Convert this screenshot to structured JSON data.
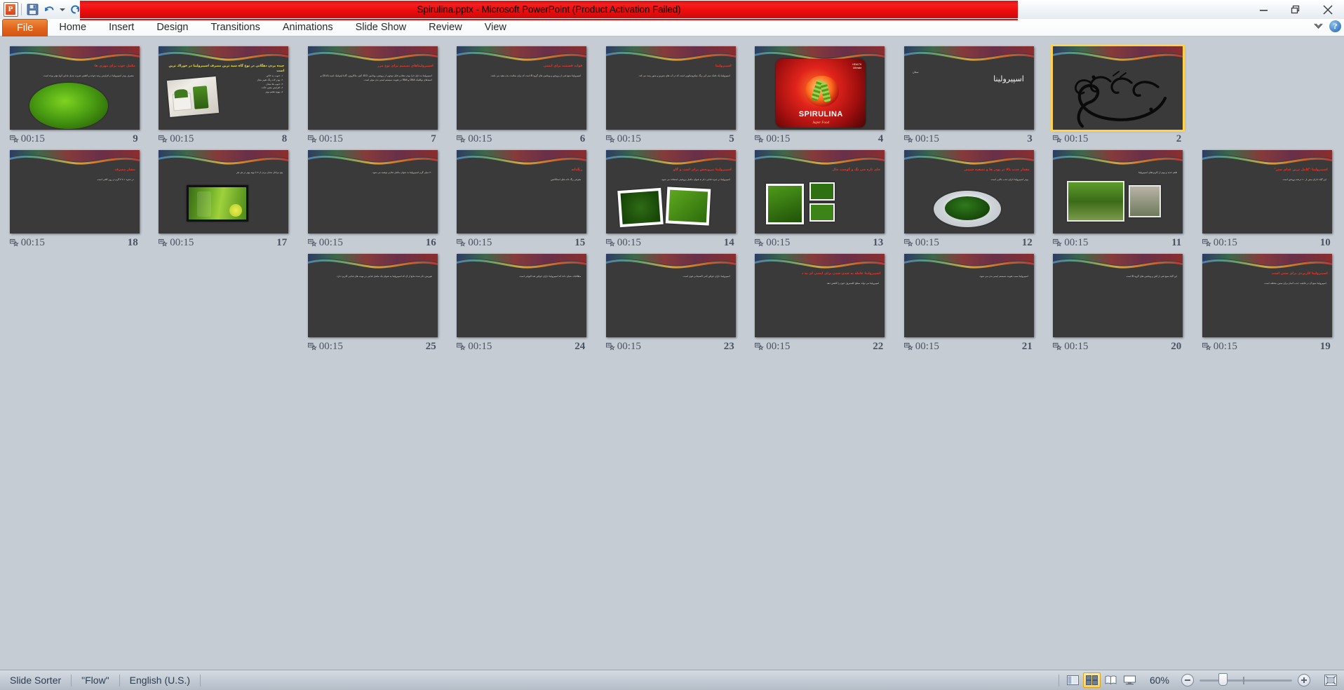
{
  "window": {
    "title": "Spirulina.pptx  -  Microsoft PowerPoint (Product Activation Failed)",
    "minimize_label": "—",
    "restore_label": "restore",
    "close_label": "✕"
  },
  "quick_access": {
    "app_logo": "P",
    "items": [
      {
        "name": "save-icon",
        "label": "Save"
      },
      {
        "name": "undo-icon",
        "label": "Undo"
      },
      {
        "name": "undo-dropdown-icon",
        "label": "Undo history"
      },
      {
        "name": "redo-icon",
        "label": "Repeat"
      },
      {
        "name": "customize-qat-icon",
        "label": "Customize Quick Access Toolbar"
      }
    ]
  },
  "ribbon": {
    "tabs": [
      {
        "label": "File",
        "active": true
      },
      {
        "label": "Home",
        "active": false
      },
      {
        "label": "Insert",
        "active": false
      },
      {
        "label": "Design",
        "active": false
      },
      {
        "label": "Transitions",
        "active": false
      },
      {
        "label": "Animations",
        "active": false
      },
      {
        "label": "Slide Show",
        "active": false
      },
      {
        "label": "Review",
        "active": false
      },
      {
        "label": "View",
        "active": false
      }
    ],
    "minimize_ribbon_label": "Minimize the Ribbon",
    "help_label": "?"
  },
  "status_bar": {
    "view_name": "Slide Sorter",
    "theme_name": "\"Flow\"",
    "language": "English (U.S.)",
    "zoom_percent": "60%",
    "view_buttons": [
      {
        "name": "view-normal",
        "label": "Normal",
        "active": false
      },
      {
        "name": "view-slide-sorter",
        "label": "Slide Sorter",
        "active": true
      },
      {
        "name": "view-reading",
        "label": "Reading View",
        "active": false
      },
      {
        "name": "view-slideshow",
        "label": "Slide Show",
        "active": false
      }
    ],
    "zoom_out_label": "Zoom Out",
    "zoom_in_label": "Zoom In",
    "fit_label": "Fit slide to current window"
  },
  "slides_common": {
    "timing": "00:15",
    "transition_icon": "transition-star-icon"
  },
  "slides": [
    {
      "number": "9",
      "row": 0,
      "col": 0,
      "selected": false,
      "kind": "title-image",
      "title": "مكمل خوب برای مهری ها",
      "body": "مصرف پودر اسپیرولینا در افزایش رشد جوجه و كاهش ضریب تبدیل غذایی آنها مؤثر بوده است.",
      "image": "green-algae-oval"
    },
    {
      "number": "8",
      "row": 0,
      "col": 1,
      "selected": false,
      "kind": "title-list-image",
      "title": "چیده بردن دهگانی در نوع گاه سیه ترین مصرف اسپیرولینا در خوراك ترین است",
      "body": "١- حبوب به خاص\n٢- پودر لانه رنگ تغییر مجاز\n٣- حبوب ها نشان\n٤- افزایش معین حالت\n٥- بهبود هضم بهتر",
      "image": "green-powder-cups"
    },
    {
      "number": "7",
      "row": 0,
      "col": 2,
      "selected": false,
      "kind": "title-text",
      "title": "اسپیرولیناهای تصمیم برای نوع مزر",
      "body": "اسپیرولینا به دلیل دارا بودن مقادیر قابل توجهی از پروتئین، ویتامین B12، آهن، بتاکاروتن، گاما لینولنیک اسید (GLA) و اسیدهای نوکلئیک DNA و RNA در تقویت سیستم ایمنی بدن مؤثر است.",
      "image": ""
    },
    {
      "number": "6",
      "row": 0,
      "col": 3,
      "selected": false,
      "kind": "title-text",
      "title": "فواید قسمت برای ایمنی",
      "body": "اسپیرولینا منبع غنی از پروتئین و ویتامین های گروه B است که برای سلامت بدن مفید می باشد.",
      "image": ""
    },
    {
      "number": "5",
      "row": 0,
      "col": 4,
      "selected": false,
      "kind": "title-text",
      "title": "اسپیرولینا",
      "body": "اسپیرولینا یک جلبک سبز آبی رنگ میکروسکوپی است که در آب های شیرین و شور رشد می کند.",
      "image": ""
    },
    {
      "number": "4",
      "row": 0,
      "col": 5,
      "selected": false,
      "kind": "product",
      "title": "SPIRULINA",
      "body": "Super Food",
      "image": "spirulina-red-box"
    },
    {
      "number": "3",
      "row": 0,
      "col": 6,
      "selected": false,
      "kind": "big-title",
      "title": "اسپیرولینا",
      "body": "",
      "image": ""
    },
    {
      "number": "2",
      "row": 0,
      "col": 7,
      "selected": true,
      "kind": "bismillah",
      "title": "بسم الله الرحمن الرحیم",
      "body": "",
      "image": "bismillah-calligraphy"
    },
    {
      "number": "18",
      "row": 1,
      "col": 0,
      "selected": false,
      "kind": "title-text",
      "title": "مشار مصرف",
      "body": "در حدود ۱ تا ۳ گرم در روز کافی است.",
      "image": ""
    },
    {
      "number": "17",
      "row": 1,
      "col": 1,
      "selected": false,
      "kind": "title-image",
      "title": "",
      "body": "پنج مراحل نشان بردن از ۳ تا تهیه بهتر در هر نفر",
      "image": "green-juice-glass"
    },
    {
      "number": "16",
      "row": 1,
      "col": 2,
      "selected": false,
      "kind": "title-text",
      "title": "",
      "body": "۳۰ میلی گرم اسپیرولینا به عنوان مکمل غذایی توصیه می شود.",
      "image": ""
    },
    {
      "number": "15",
      "row": 1,
      "col": 3,
      "selected": false,
      "kind": "title-text",
      "title": "رنگدانه",
      "body": "معرفی رنگ دانه های استاکانتین",
      "image": ""
    },
    {
      "number": "14",
      "row": 1,
      "col": 4,
      "selected": false,
      "kind": "title-image2",
      "title": "اسپیرولینا نیروبخش برای اسب و گاو",
      "body": "اسپیرولینا در جیره غذایی دام به عنوان مکمل پروتئینی استفاده می شود.",
      "image": "algae-two-photos"
    },
    {
      "number": "13",
      "row": 1,
      "col": 5,
      "selected": false,
      "kind": "title-image2",
      "title": "جای تازه جی نگ و گوست چال",
      "body": "",
      "image": "algae-grid-photos"
    },
    {
      "number": "12",
      "row": 1,
      "col": 6,
      "selected": false,
      "kind": "title-image",
      "title": "مقدار جذب بالا تر پودر ها و تصفیه شیمی",
      "body": "پودر اسپیرولینا دارای جذب بالایی است.",
      "image": "spirulina-powder-plate"
    },
    {
      "number": "11",
      "row": 1,
      "col": 7,
      "selected": false,
      "kind": "title-image",
      "title": "",
      "body": "طعم جدید و بهتر از کاربردهای اسپیرولینا",
      "image": "algae-farm-tanks"
    },
    {
      "number": "10",
      "row": 1,
      "col": 8,
      "selected": false,
      "kind": "title-text",
      "title": "اسپیرولینا \"کامل ترین غذای سبز\"",
      "body": "این گیاه دارای بیش از ۶۰ درصد پروتئین است.",
      "image": ""
    },
    {
      "number": "25",
      "row": 2,
      "col": 2,
      "selected": false,
      "kind": "text-only",
      "title": "",
      "body": "هوریش ذکر شده مانع از آن که اسپیرولینا به عنوان یک مکمل غذایی در نوبت های غذایی کاربرد دارد.",
      "image": ""
    },
    {
      "number": "24",
      "row": 2,
      "col": 3,
      "selected": false,
      "kind": "text-only",
      "title": "",
      "body": "مطالعات نشان داده که اسپیرولینا دارای خواص ضد التهابی است.",
      "image": ""
    },
    {
      "number": "23",
      "row": 2,
      "col": 4,
      "selected": false,
      "kind": "text-only",
      "title": "",
      "body": "اسپیرولینا دارای خواص آنتی اکسیدانی قوی است.",
      "image": ""
    },
    {
      "number": "22",
      "row": 2,
      "col": 5,
      "selected": false,
      "kind": "title-text",
      "title": "اسپیرولینا عامله به شدن شدن برای ایمنی ای به د",
      "body": "اسپیرولینا می تواند سطح کلسترول خون را کاهش دهد.",
      "image": ""
    },
    {
      "number": "21",
      "row": 2,
      "col": 6,
      "selected": false,
      "kind": "text-only",
      "title": "",
      "body": "اسپیرولینا سبب تقویت سیستم ایمنی بدن می شود.",
      "image": ""
    },
    {
      "number": "20",
      "row": 2,
      "col": 7,
      "selected": false,
      "kind": "text-only",
      "title": "",
      "body": "این گیاه منبع غنی از آهن و ویتامین های گروه B است.",
      "image": ""
    },
    {
      "number": "19",
      "row": 2,
      "col": 8,
      "selected": false,
      "kind": "title-text",
      "title": "اسپیرولینا کاربردی برای سنی است",
      "body": "اسپیرولینا منبع آن در قابلیت جذب آسان برای سنین مختلف است.",
      "image": ""
    }
  ]
}
